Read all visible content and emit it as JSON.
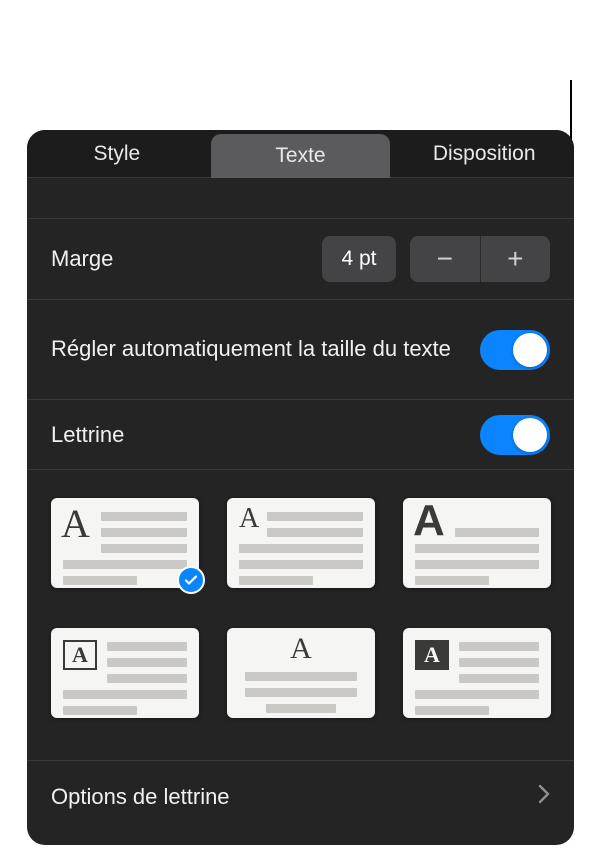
{
  "tabs": {
    "style": "Style",
    "texte": "Texte",
    "disposition": "Disposition",
    "active": "texte"
  },
  "marge": {
    "label": "Marge",
    "value": "4 pt"
  },
  "autoresize": {
    "label": "Régler automatiquement la taille du texte",
    "on": true
  },
  "lettrine": {
    "label": "Lettrine",
    "on": true
  },
  "dropcap_styles": {
    "selected_index": 0,
    "count": 6
  },
  "options": {
    "label": "Options de lettrine"
  },
  "colors": {
    "accent": "#0a84ff",
    "panel_bg": "#242424"
  }
}
